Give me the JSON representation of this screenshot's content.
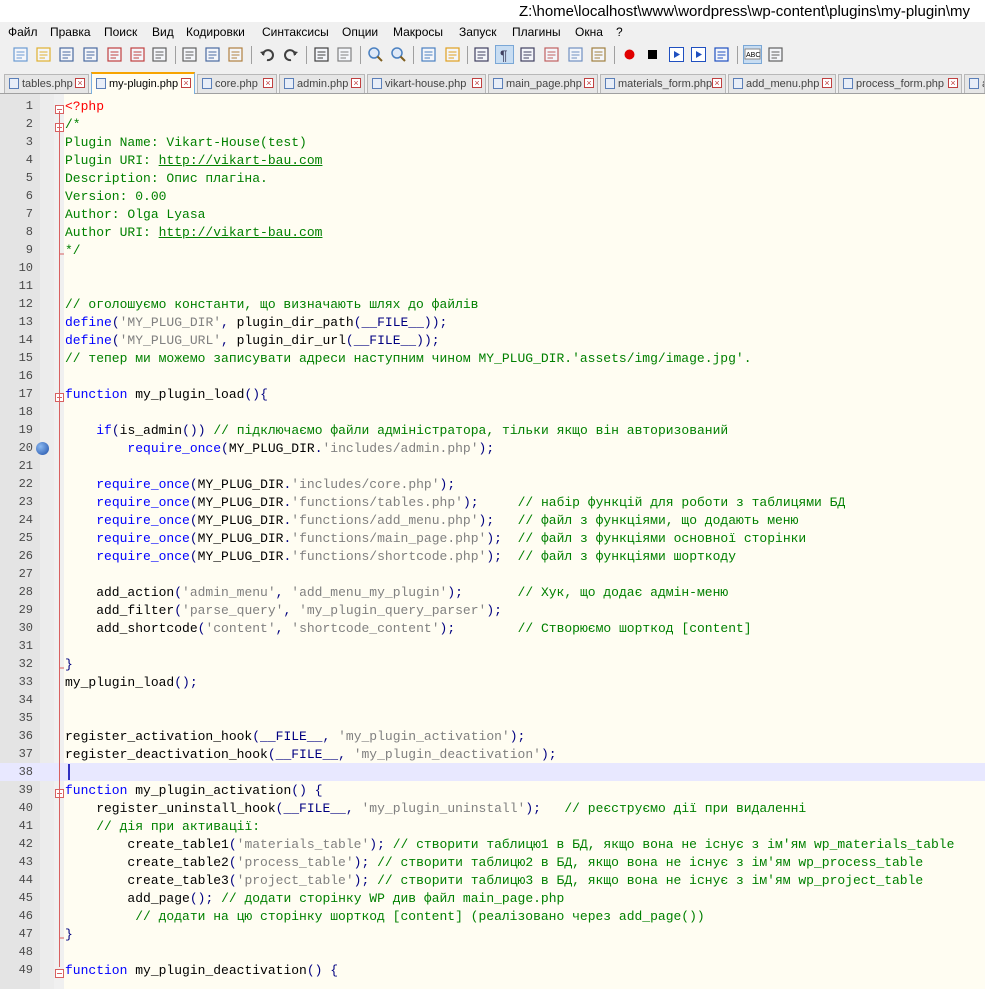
{
  "window": {
    "title": "Z:\\home\\localhost\\www\\wordpress\\wp-content\\plugins\\my-plugin\\my"
  },
  "menu": [
    "Файл",
    "Правка",
    "Поиск",
    "Вид",
    "Кодировки",
    "Синтаксисы",
    "Опции",
    "Макросы",
    "Запуск",
    "Плагины",
    "Окна",
    "?"
  ],
  "toolbar": [
    {
      "name": "new-file-icon"
    },
    {
      "name": "open-file-icon"
    },
    {
      "name": "save-icon"
    },
    {
      "name": "save-all-icon"
    },
    {
      "name": "close-icon"
    },
    {
      "name": "close-all-icon"
    },
    {
      "name": "print-icon"
    },
    {
      "name": "cut-icon"
    },
    {
      "name": "copy-icon"
    },
    {
      "name": "paste-icon"
    },
    {
      "name": "undo-icon"
    },
    {
      "name": "redo-icon"
    },
    {
      "name": "find-icon"
    },
    {
      "name": "replace-icon"
    },
    {
      "name": "zoom-in-icon"
    },
    {
      "name": "zoom-out-icon"
    },
    {
      "name": "sync-vertical-icon"
    },
    {
      "name": "sync-horizontal-icon"
    },
    {
      "name": "word-wrap-icon"
    },
    {
      "name": "show-all-chars-icon"
    },
    {
      "name": "indent-guide-icon"
    },
    {
      "name": "udl-icon"
    },
    {
      "name": "doc-map-icon"
    },
    {
      "name": "function-list-icon"
    },
    {
      "name": "record-macro-icon"
    },
    {
      "name": "stop-macro-icon"
    },
    {
      "name": "play-macro-icon"
    },
    {
      "name": "run-macro-multiple-icon"
    },
    {
      "name": "save-macro-icon"
    },
    {
      "name": "spell-check-icon"
    },
    {
      "name": "spell-check-options-icon"
    }
  ],
  "tabs": [
    {
      "label": "tables.php",
      "active": false
    },
    {
      "label": "my-plugin.php",
      "active": true
    },
    {
      "label": "core.php",
      "active": false
    },
    {
      "label": "admin.php",
      "active": false
    },
    {
      "label": "vikart-house.php",
      "active": false
    },
    {
      "label": "main_page.php",
      "active": false
    },
    {
      "label": "materials_form.php",
      "active": false
    },
    {
      "label": "add_menu.php",
      "active": false
    },
    {
      "label": "process_form.php",
      "active": false
    },
    {
      "label": "a",
      "active": false
    }
  ],
  "editor": {
    "current_line": 38,
    "bookmark_line": 20,
    "lines": [
      {
        "n": 1,
        "t": "<?php"
      },
      {
        "n": 2,
        "t": "/*"
      },
      {
        "n": 3,
        "t": "Plugin Name: Vikart-House(test)"
      },
      {
        "n": 4,
        "t": "Plugin URI: http://vikart-bau.com"
      },
      {
        "n": 5,
        "t": "Description: Опис плагіна."
      },
      {
        "n": 6,
        "t": "Version: 0.00"
      },
      {
        "n": 7,
        "t": "Author: Olga Lyasa"
      },
      {
        "n": 8,
        "t": "Author URI: http://vikart-bau.com"
      },
      {
        "n": 9,
        "t": "*/"
      },
      {
        "n": 10,
        "t": ""
      },
      {
        "n": 11,
        "t": ""
      },
      {
        "n": 12,
        "t": "// оголошуємо константи, що визначають шлях до файлів"
      },
      {
        "n": 13,
        "t": "define('MY_PLUG_DIR', plugin_dir_path(__FILE__));"
      },
      {
        "n": 14,
        "t": "define('MY_PLUG_URL', plugin_dir_url(__FILE__));"
      },
      {
        "n": 15,
        "t": "// тепер ми можемо записувати адреси наступним чином MY_PLUG_DIR.'assets/img/image.jpg'."
      },
      {
        "n": 16,
        "t": ""
      },
      {
        "n": 17,
        "t": "function my_plugin_load(){"
      },
      {
        "n": 18,
        "t": ""
      },
      {
        "n": 19,
        "t": "    if(is_admin()) // підключаємо файли адміністратора, тільки якщо він авторизований"
      },
      {
        "n": 20,
        "t": "        require_once(MY_PLUG_DIR.'includes/admin.php');"
      },
      {
        "n": 21,
        "t": ""
      },
      {
        "n": 22,
        "t": "    require_once(MY_PLUG_DIR.'includes/core.php');"
      },
      {
        "n": 23,
        "t": "    require_once(MY_PLUG_DIR.'functions/tables.php');     // набір функцій для роботи з таблицями БД"
      },
      {
        "n": 24,
        "t": "    require_once(MY_PLUG_DIR.'functions/add_menu.php');   // файл з функціями, що додають меню"
      },
      {
        "n": 25,
        "t": "    require_once(MY_PLUG_DIR.'functions/main_page.php');  // файл з функціями основної сторінки"
      },
      {
        "n": 26,
        "t": "    require_once(MY_PLUG_DIR.'functions/shortcode.php');  // файл з функціями шорткоду"
      },
      {
        "n": 27,
        "t": ""
      },
      {
        "n": 28,
        "t": "    add_action('admin_menu', 'add_menu_my_plugin');       // Хук, що додає адмін-меню"
      },
      {
        "n": 29,
        "t": "    add_filter('parse_query', 'my_plugin_query_parser');"
      },
      {
        "n": 30,
        "t": "    add_shortcode('content', 'shortcode_content');        // Створюємо шорткод [content]"
      },
      {
        "n": 31,
        "t": ""
      },
      {
        "n": 32,
        "t": "}"
      },
      {
        "n": 33,
        "t": "my_plugin_load();"
      },
      {
        "n": 34,
        "t": ""
      },
      {
        "n": 35,
        "t": ""
      },
      {
        "n": 36,
        "t": "register_activation_hook(__FILE__, 'my_plugin_activation');"
      },
      {
        "n": 37,
        "t": "register_deactivation_hook(__FILE__, 'my_plugin_deactivation');"
      },
      {
        "n": 38,
        "t": ""
      },
      {
        "n": 39,
        "t": "function my_plugin_activation() {"
      },
      {
        "n": 40,
        "t": "    register_uninstall_hook(__FILE__, 'my_plugin_uninstall');   // реєструємо дії при видаленні"
      },
      {
        "n": 41,
        "t": "    // дія при активації:"
      },
      {
        "n": 42,
        "t": "        create_table1('materials_table'); // створити таблицю1 в БД, якщо вона не існує з ім'ям wp_materials_table"
      },
      {
        "n": 43,
        "t": "        create_table2('process_table'); // створити таблицю2 в БД, якщо вона не існує з ім'ям wp_process_table"
      },
      {
        "n": 44,
        "t": "        create_table3('project_table'); // створити таблицю3 в БД, якщо вона не існує з ім'ям wp_project_table"
      },
      {
        "n": 45,
        "t": "        add_page(); // додати сторінку WP див файл main_page.php"
      },
      {
        "n": 46,
        "t": "         // додати на цю сторінку шорткод [content] (реалізовано через add_page())"
      },
      {
        "n": 47,
        "t": "}"
      },
      {
        "n": 48,
        "t": ""
      },
      {
        "n": 49,
        "t": "function my_plugin_deactivation() {"
      }
    ]
  },
  "colors": {
    "keyword": "#0000ff",
    "string": "#808080",
    "comment": "#008000",
    "operator": "#000080",
    "php_tag": "#ff0000",
    "background": "#fffdf2",
    "current_line": "#e8e8ff"
  }
}
